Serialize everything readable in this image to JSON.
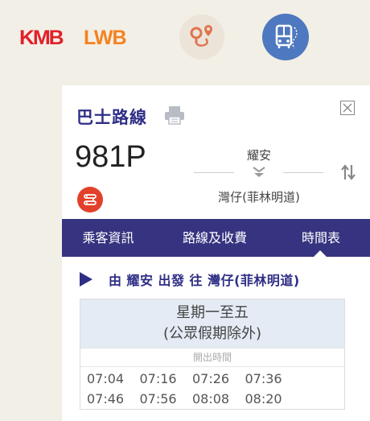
{
  "header": {
    "logo_kmb": "KMB",
    "logo_lwb": "LWB",
    "route_search_icon": "route-pin-icon",
    "bus_route_icon": "bus-route-icon"
  },
  "panel": {
    "title": "巴士路線",
    "route_no": "981P",
    "origin": "耀安",
    "destination": "灣仔(菲林明道)"
  },
  "tabs": [
    {
      "label": "乘客資訊"
    },
    {
      "label": "路線及收費"
    },
    {
      "label": "時間表"
    }
  ],
  "direction": {
    "from_word": "由",
    "origin": "耀安",
    "depart_word": "出發",
    "to_word": "往",
    "destination": "灣仔(菲林明道)"
  },
  "timetable": {
    "days": "星期一至五",
    "days_note": "(公眾假期除外)",
    "column_label": "開出時間",
    "times": [
      "07:04",
      "07:16",
      "07:26",
      "07:36",
      "07:46",
      "07:56",
      "08:08",
      "08:20"
    ]
  },
  "colors": {
    "brand_navy": "#363480",
    "kmb_red": "#e2202a",
    "lwb_orange": "#f58220",
    "bus_blue": "#4e78bf"
  }
}
